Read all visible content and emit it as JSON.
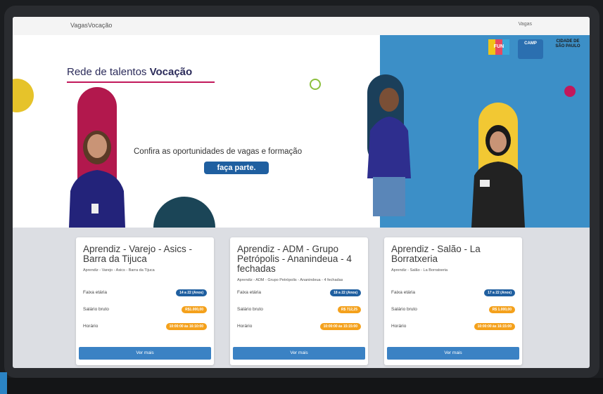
{
  "topbar": {
    "brand": "VagasVocação",
    "nav_link": "Vagas"
  },
  "hero": {
    "title_prefix": "Rede de talentos ",
    "title_bold": "Vocação",
    "tagline": "Confira as oportunidades de vagas e formação",
    "cta": "faça parte.",
    "logos": [
      "FUN",
      "CAMP",
      "CIDADE DE SÃO PAULO"
    ]
  },
  "cards": [
    {
      "title": "Aprendiz - Varejo - Asics - Barra da Tijuca",
      "subtitle": "Aprendiz - Varejo - Asics - Barra da Tijuca",
      "age_label": "Faixa etária",
      "age_value": "14 a 22 (Anos)",
      "salary_label": "Salário bruto",
      "salary_value": "R$1.000,00",
      "hours_label": "Horário",
      "hours_value": "10:00:00 às 16:10:00",
      "button": "Ver mais"
    },
    {
      "title": "Aprendiz - ADM - Grupo Petrópolis - Ananindeua - 4 fechadas",
      "subtitle": "Aprendiz - ADM - Grupo Petrópolis - Ananindeua - 4 fechadas",
      "age_label": "Faixa etária",
      "age_value": "18 a 22 (Anos)",
      "salary_label": "Salário bruto",
      "salary_value": "R$ 712,25",
      "hours_label": "Horário",
      "hours_value": "10:00:00 às 15:15:00",
      "button": "Ver mais"
    },
    {
      "title": "Aprendiz - Salão - La Borratxeria",
      "subtitle": "Aprendiz - Salão - La Borratxeria",
      "age_label": "Faixa etária",
      "age_value": "17 a 22 (Anos)",
      "salary_label": "Salário bruto",
      "salary_value": "R$ 1.000,00",
      "hours_label": "Horário",
      "hours_value": "10:00:00 às 16:15:00",
      "button": "Ver mais"
    }
  ],
  "colors": {
    "primary_blue": "#1f5fa0",
    "button_blue": "#3b82c4",
    "accent_orange": "#f4a11c",
    "accent_magenta": "#c2185b",
    "hero_blue": "#3c8fc7"
  }
}
